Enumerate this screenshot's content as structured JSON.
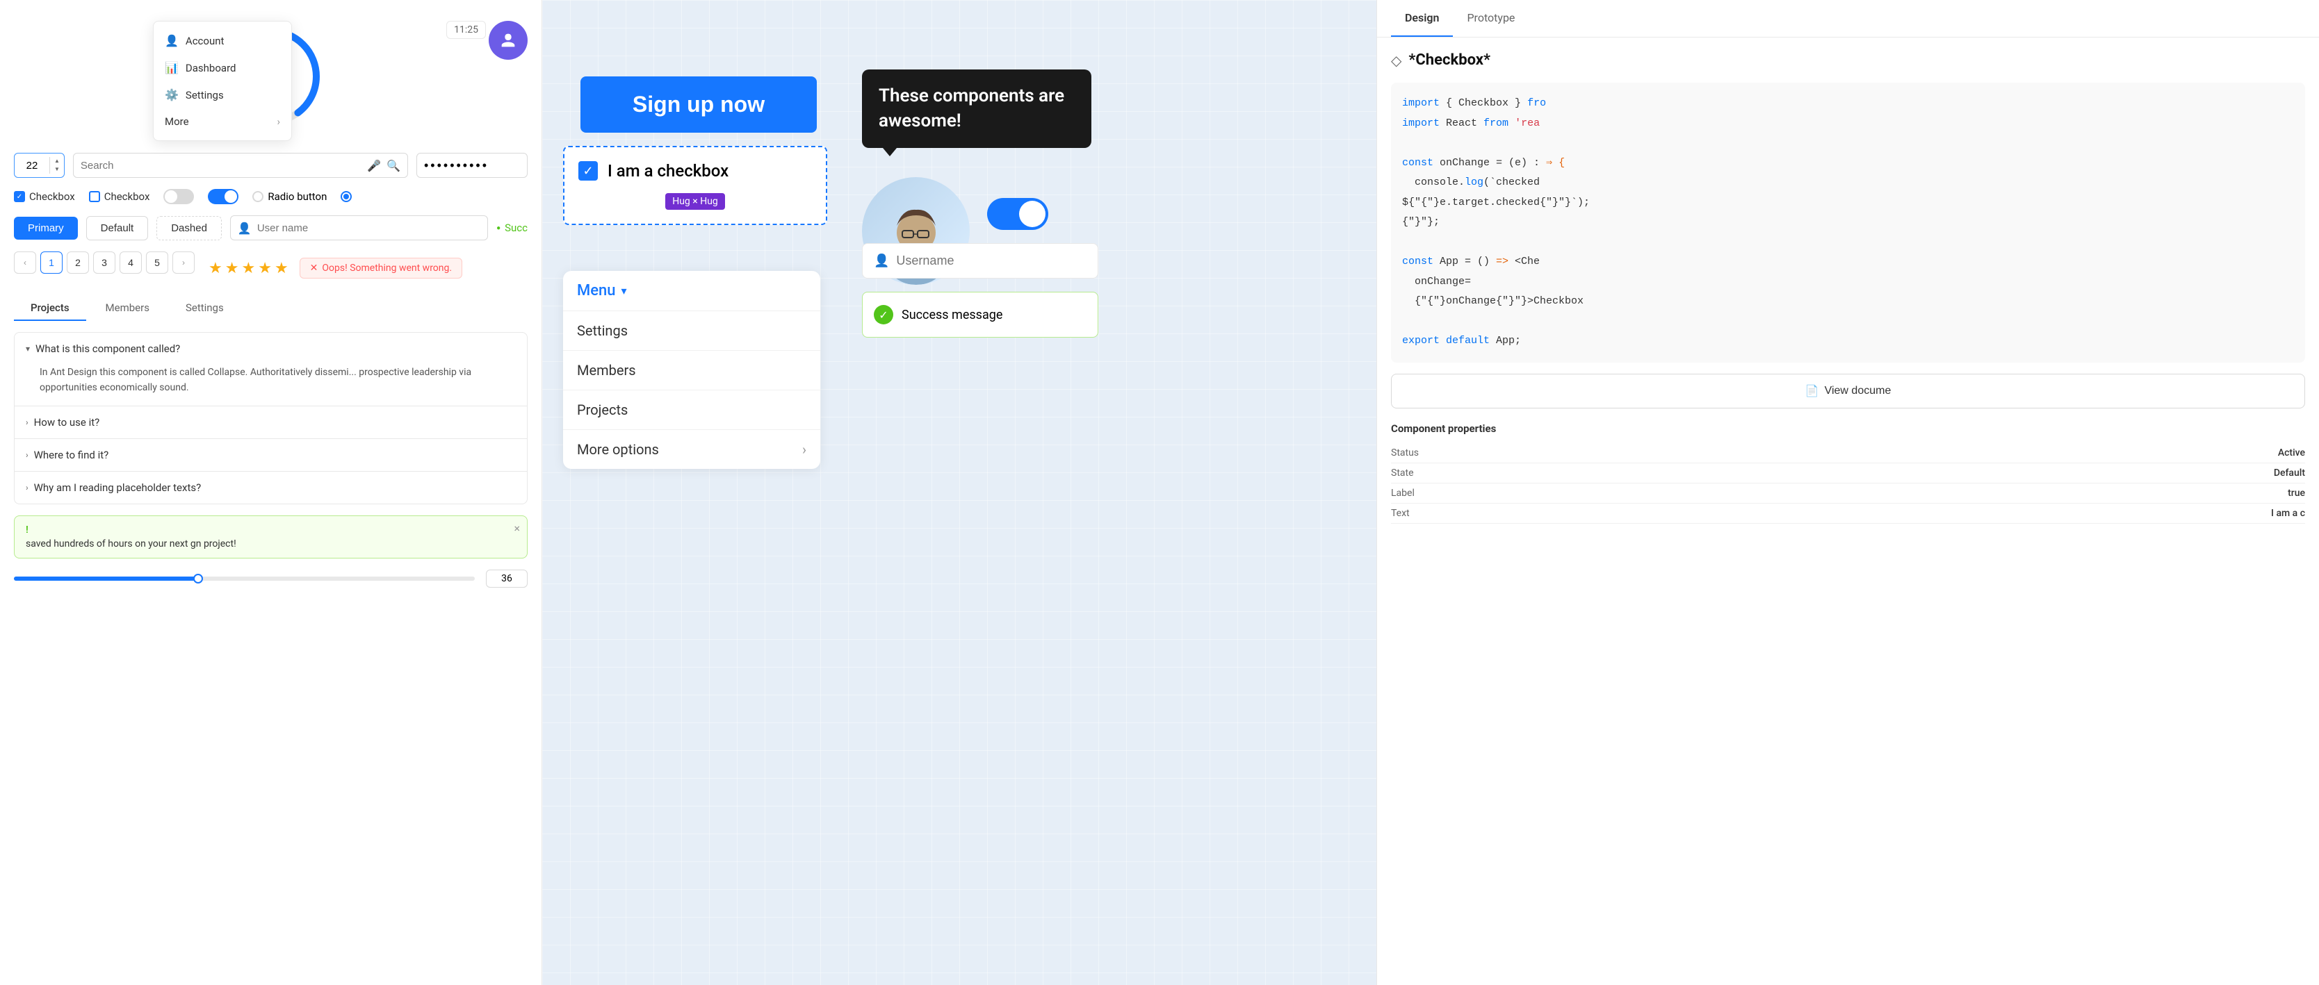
{
  "left": {
    "progress_percent": "40%",
    "time_label": "11:25",
    "dropdown": {
      "items": [
        {
          "icon": "👤",
          "label": "Account",
          "hasArrow": false
        },
        {
          "icon": "📊",
          "label": "Dashboard",
          "hasArrow": false
        },
        {
          "icon": "⚙️",
          "label": "Settings",
          "hasArrow": false
        },
        {
          "icon": "",
          "label": "More",
          "hasArrow": true
        }
      ]
    },
    "number_input": {
      "value": "22"
    },
    "search": {
      "placeholder": "Search"
    },
    "checkboxes": [
      {
        "label": "Checkbox",
        "checked": true,
        "color": "blue"
      },
      {
        "label": "Checkbox",
        "checked": false,
        "color": "blue"
      },
      {
        "label": "Radio button",
        "type": "radio"
      },
      {
        "label": "",
        "type": "radio-selected"
      }
    ],
    "buttons": [
      {
        "label": "Primary",
        "type": "primary"
      },
      {
        "label": "Default",
        "type": "default"
      },
      {
        "label": "Dashed",
        "type": "dashed"
      }
    ],
    "user_name_placeholder": "User name",
    "success_label": "Succ",
    "pagination": {
      "pages": [
        "1",
        "2",
        "3",
        "4",
        "5"
      ],
      "active": "1"
    },
    "error_msg": "Oops! Something went wrong.",
    "tabs": [
      {
        "label": "Projects"
      },
      {
        "label": "Members"
      },
      {
        "label": "Settings"
      }
    ],
    "collapse": {
      "items": [
        {
          "title": "What is this component called?",
          "open": true,
          "content": "In Ant Design this component is called Collapse. Authoritatively dissemi... prospective leadership via opportunities economically sound."
        },
        {
          "title": "How to use it?",
          "open": false
        },
        {
          "title": "Where to find it?",
          "open": false
        },
        {
          "title": "Why am I reading placeholder texts?",
          "open": false
        }
      ]
    },
    "slider_value": "36",
    "alert": {
      "title": "!",
      "body": "saved hundreds of hours on your next gn project!"
    }
  },
  "middle": {
    "signup_btn": "Sign up now",
    "checkbox_label": "I am a checkbox",
    "hug_label": "Hug × Hug",
    "menu": {
      "title": "Menu",
      "items": [
        "Settings",
        "Members",
        "Projects"
      ],
      "more_label": "More options"
    },
    "tooltip": "These components are awesome!",
    "username_placeholder": "Username",
    "success_message": "Success message",
    "code": {
      "line1": "import { Checkbox } fro",
      "line2": "import React from 'rea",
      "line3": "",
      "line4": "const onChange = (e) :",
      "line5": "  console.log(`checked",
      "line6": "${e.target.checked}`);",
      "line7": "};",
      "line8": "",
      "line9": "const App = () => <Che",
      "line10": "onChange=",
      "line11": "{onChange}>Checkbox",
      "line12": "",
      "line13": "export default App;"
    },
    "view_doc_label": "View docume"
  },
  "right": {
    "tabs": [
      {
        "label": "Design",
        "active": true
      },
      {
        "label": "Prototype",
        "active": false
      }
    ],
    "component_name": "*Checkbox*",
    "code_lines": [
      "import { Checkbox } fro",
      "import React from 'rea",
      "",
      "const onChange = (e) :",
      "  console.log(`checked",
      "${e.target.checked}`);",
      "};",
      "",
      "const App = () => <Che",
      "onChange=",
      "{onChange}>Checkbox",
      "",
      "export default App;"
    ],
    "view_doc_btn": "View docume",
    "properties": {
      "title": "Component properties",
      "rows": [
        {
          "label": "Status",
          "value": "Active"
        },
        {
          "label": "State",
          "value": "Default"
        },
        {
          "label": "Label",
          "value": "true"
        },
        {
          "label": "Text",
          "value": "I am a c"
        }
      ]
    }
  }
}
